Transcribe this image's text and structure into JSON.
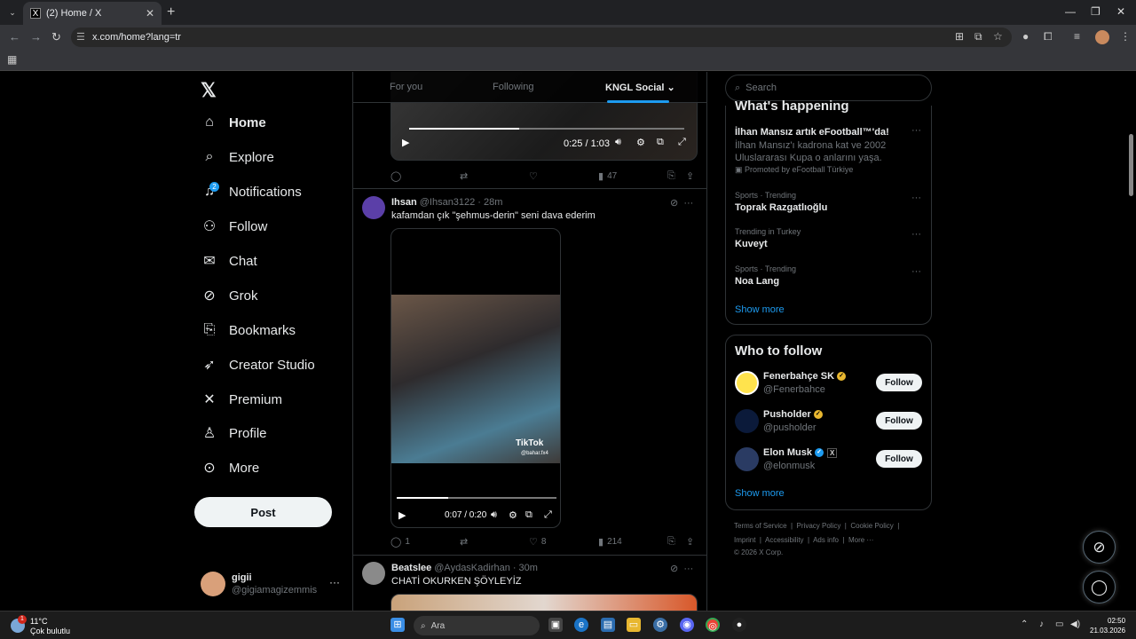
{
  "browser": {
    "tab_title": "(2) Home / X",
    "url": "x.com/home?lang=tr"
  },
  "sidebar": {
    "items": [
      {
        "label": "Home",
        "icon": "home-icon"
      },
      {
        "label": "Explore",
        "icon": "search-icon"
      },
      {
        "label": "Notifications",
        "icon": "bell-icon",
        "badge": "2"
      },
      {
        "label": "Follow",
        "icon": "person-add-icon"
      },
      {
        "label": "Chat",
        "icon": "mail-icon"
      },
      {
        "label": "Grok",
        "icon": "grok-icon"
      },
      {
        "label": "Bookmarks",
        "icon": "bookmark-icon"
      },
      {
        "label": "Creator Studio",
        "icon": "rocket-icon"
      },
      {
        "label": "Premium",
        "icon": "x-icon"
      },
      {
        "label": "Profile",
        "icon": "person-icon"
      },
      {
        "label": "More",
        "icon": "more-circle-icon"
      }
    ],
    "post_label": "Post",
    "account": {
      "name": "gigii",
      "handle": "@gigiamagizemmis"
    }
  },
  "feed": {
    "tabs": [
      "For you",
      "Following",
      "KNGL Social"
    ],
    "tweet0": {
      "video_time": "0:25 / 1:03",
      "views": "47"
    },
    "tweet1": {
      "name": "Ihsan",
      "handle": "@Ihsan3122",
      "time": "28m",
      "text": "kafamdan çık \"şehmus-derin\" seni dava ederim",
      "video_time": "0:07 / 0:20",
      "watermark": "TikTok",
      "watermark_handle": "@bahar.fx4",
      "replies": "1",
      "likes": "8",
      "views": "214"
    },
    "tweet2": {
      "name": "Beatslee",
      "handle": "@AydasKadirhan",
      "time": "30m",
      "text": "CHATİ OKURKEN ŞÖYLEYİZ"
    }
  },
  "right": {
    "search_placeholder": "Search",
    "happening_title": "What's happening",
    "trends": [
      {
        "name": "İlhan Mansız artık eFootball™'da!",
        "desc": "İlhan Mansız'ı kadrona kat ve 2002 Uluslararası Kupa o anlarını yaşa.",
        "promo": "Promoted by eFootball Türkiye"
      },
      {
        "context": "Sports · Trending",
        "name": "Toprak Razgatlıoğlu"
      },
      {
        "context": "Trending in Turkey",
        "name": "Kuveyt"
      },
      {
        "context": "Sports · Trending",
        "name": "Noa Lang"
      }
    ],
    "show_more": "Show more",
    "wtf_title": "Who to follow",
    "wtf": [
      {
        "name": "Fenerbahçe SK",
        "handle": "@Fenerbahce",
        "badge": "gold"
      },
      {
        "name": "Pusholder",
        "handle": "@pusholder",
        "badge": "gold"
      },
      {
        "name": "Elon Musk",
        "handle": "@elonmusk",
        "badge": "blue"
      }
    ],
    "follow_label": "Follow",
    "footer": {
      "line1": [
        "Terms of Service",
        "Privacy Policy",
        "Cookie Policy"
      ],
      "line2": [
        "Imprint",
        "Accessibility",
        "Ads info",
        "More ···"
      ],
      "copyright": "© 2026 X Corp."
    }
  },
  "taskbar": {
    "weather_temp": "11°C",
    "weather_desc": "Çok bulutlu",
    "weather_badge": "1",
    "search_label": "Ara",
    "time": "02:50",
    "date": "21.03.2026"
  },
  "colors": {
    "accent": "#1d9bf0",
    "bg": "#000000",
    "muted": "#71767b"
  }
}
